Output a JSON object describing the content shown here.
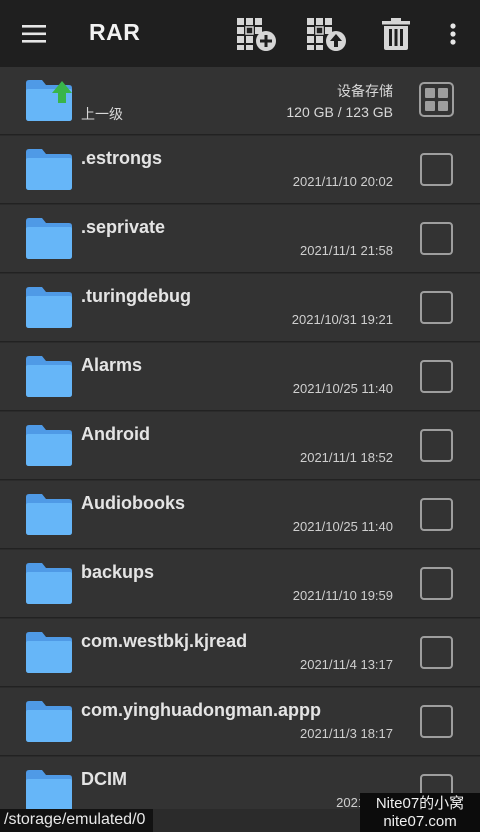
{
  "app": {
    "title": "RAR"
  },
  "toolbar": {
    "menu_icon": "hamburger-menu-icon",
    "add_icon": "add-to-archive-icon",
    "extract_icon": "extract-from-archive-icon",
    "delete_icon": "trash-icon",
    "more_icon": "more-vertical-icon"
  },
  "parent": {
    "label": "上一级",
    "storage_name": "设备存储",
    "storage_size": "120 GB / 123 GB",
    "view_toggle_icon": "grid-view-icon"
  },
  "files": [
    {
      "name": ".estrongs",
      "date": "2021/11/10 20:02"
    },
    {
      "name": ".seprivate",
      "date": "2021/11/1 21:58"
    },
    {
      "name": ".turingdebug",
      "date": "2021/10/31 19:21"
    },
    {
      "name": "Alarms",
      "date": "2021/10/25 11:40"
    },
    {
      "name": "Android",
      "date": "2021/11/1 18:52"
    },
    {
      "name": "Audiobooks",
      "date": "2021/10/25 11:40"
    },
    {
      "name": "backups",
      "date": "2021/11/10 19:59"
    },
    {
      "name": "com.westbkj.kjread",
      "date": "2021/11/4 13:17"
    },
    {
      "name": "com.yinghuadongman.appp",
      "date": "2021/11/3 18:17"
    },
    {
      "name": "DCIM",
      "date": "2021/11/1"
    }
  ],
  "status": {
    "path": "/storage/emulated/0"
  },
  "watermark": {
    "line1": "Nite07的小窝",
    "line2": "nite07.com"
  },
  "colors": {
    "toolbar": "#1f1f1f",
    "row": "#333333",
    "folder": "#64b5f6",
    "up_arrow": "#4caf50"
  }
}
